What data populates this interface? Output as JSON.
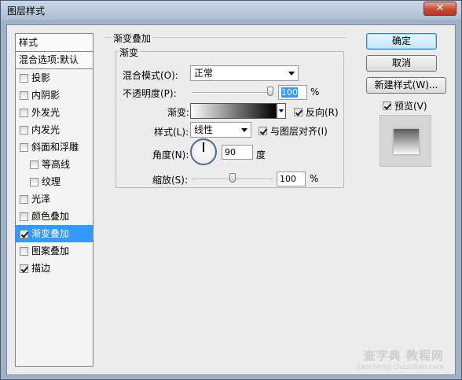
{
  "window": {
    "title": "图层样式",
    "close_glyph": "✕"
  },
  "style_list": {
    "header": "样式",
    "blend_options": "混合选项:默认",
    "items": [
      {
        "label": "投影",
        "checked": false,
        "indent": false,
        "selected": false
      },
      {
        "label": "内阴影",
        "checked": false,
        "indent": false,
        "selected": false
      },
      {
        "label": "外发光",
        "checked": false,
        "indent": false,
        "selected": false
      },
      {
        "label": "内发光",
        "checked": false,
        "indent": false,
        "selected": false
      },
      {
        "label": "斜面和浮雕",
        "checked": false,
        "indent": false,
        "selected": false
      },
      {
        "label": "等高线",
        "checked": false,
        "indent": true,
        "selected": false
      },
      {
        "label": "纹理",
        "checked": false,
        "indent": true,
        "selected": false
      },
      {
        "label": "光泽",
        "checked": false,
        "indent": false,
        "selected": false
      },
      {
        "label": "颜色叠加",
        "checked": false,
        "indent": false,
        "selected": false
      },
      {
        "label": "渐变叠加",
        "checked": true,
        "indent": false,
        "selected": true
      },
      {
        "label": "图案叠加",
        "checked": false,
        "indent": false,
        "selected": false
      },
      {
        "label": "描边",
        "checked": true,
        "indent": false,
        "selected": false
      }
    ]
  },
  "gradient_overlay": {
    "group_title": "渐变叠加",
    "sub_title": "渐变",
    "blend_mode_label": "混合模式(O):",
    "blend_mode_value": "正常",
    "opacity_label": "不透明度(P):",
    "opacity_value": "100",
    "opacity_unit": "%",
    "opacity_level": 1.0,
    "gradient_label": "渐变:",
    "reverse_label": "反向(R)",
    "reverse_checked": true,
    "style_label": "样式(L):",
    "style_value": "线性",
    "align_label": "与图层对齐(I)",
    "align_checked": true,
    "angle_label": "角度(N):",
    "angle_value": "90",
    "angle_unit": "度",
    "scale_label": "缩放(S):",
    "scale_value": "100",
    "scale_unit": "%",
    "scale_level": 0.5
  },
  "buttons": {
    "ok": "确定",
    "cancel": "取消",
    "new_style": "新建样式(W)...",
    "preview_label": "预览(V)",
    "preview_checked": true
  },
  "watermark": {
    "big": "查字典 教程网",
    "small": "jiaocheng.chazidian.com"
  },
  "colors": {
    "selected_row": "#3399ff",
    "title_bar": "#aebfd4",
    "dialog_bg": "#ececec"
  }
}
